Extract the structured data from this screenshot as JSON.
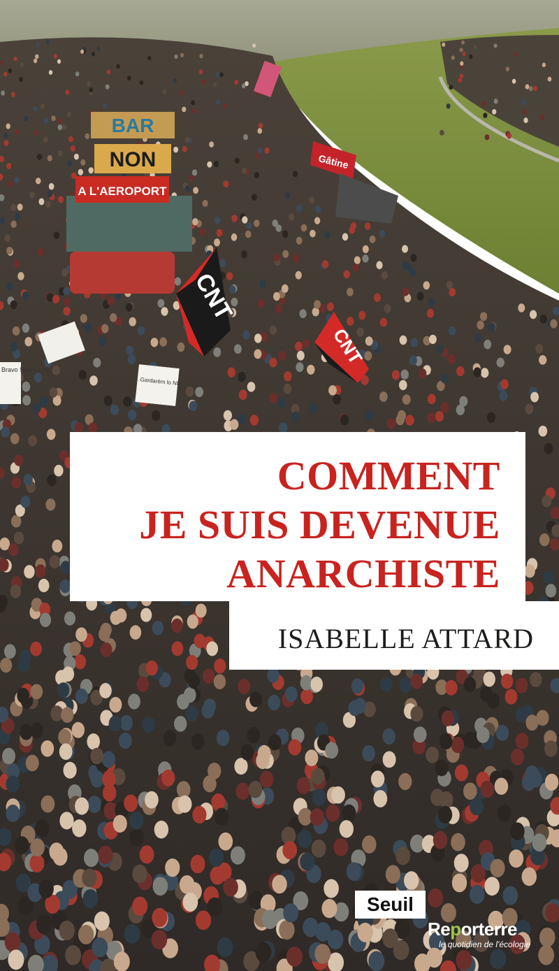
{
  "cover": {
    "title_lines": [
      "COMMENT",
      "JE SUIS DEVENUE",
      "ANARCHISTE"
    ],
    "author": "ISABELLE ATTARD",
    "publisher": "Seuil",
    "partner": {
      "name_part1": "Re",
      "name_accent": "p",
      "name_part2": "orterre",
      "tagline": "le quotidien de l'écologie"
    },
    "photo_signs": {
      "bar_sign": "BAR",
      "non_sign": "NON",
      "aeroport_sign": "A L'AEROPORT",
      "flag_left": "CNT",
      "flag_right": "CNT",
      "flag_top": "Gâtine",
      "placard_left": "Bravo ! ouve rzac",
      "placard_mid": "Gardarèm lo NDL"
    }
  },
  "colors": {
    "title_red": "#c8231f",
    "sky": "#9aa08a",
    "grass": "#7a8a3c",
    "crowd_dark": "#3a3530"
  }
}
